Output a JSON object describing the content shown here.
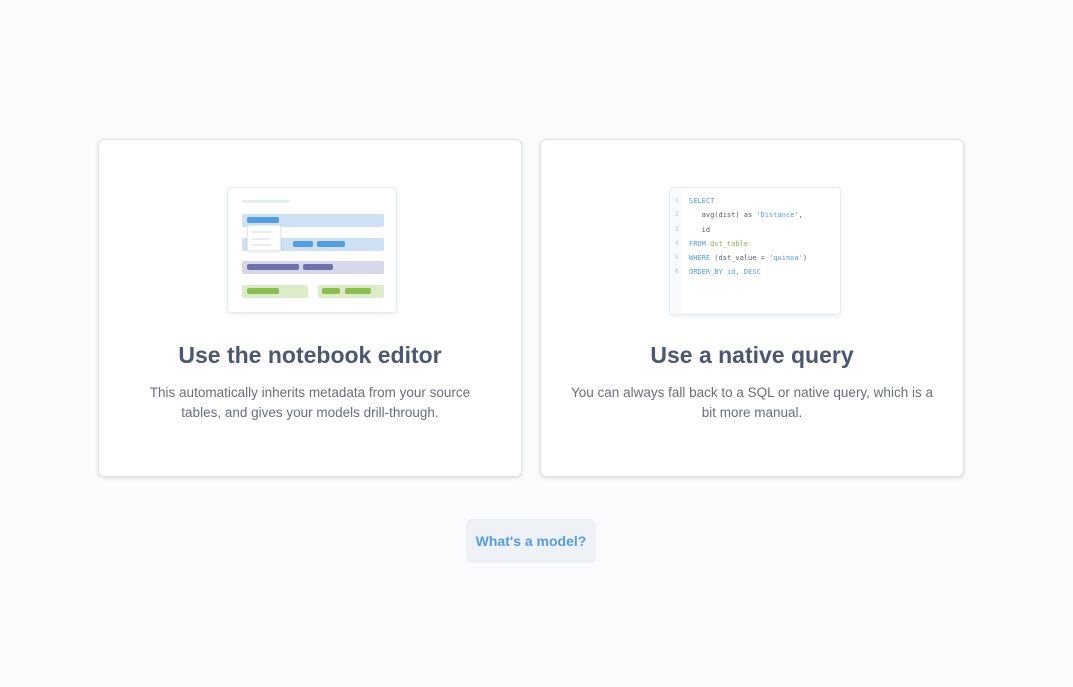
{
  "options": [
    {
      "title": "Use the notebook editor",
      "description": "This automatically inherits metadata from your source tables, and gives your models drill-through."
    },
    {
      "title": "Use a native query",
      "description": "You can always fall back to a SQL or native query, which is a bit more manual."
    }
  ],
  "code_sample": {
    "lines": [
      {
        "num": "1",
        "parts": [
          {
            "t": "SELECT",
            "c": "kw"
          }
        ]
      },
      {
        "num": "2",
        "parts": [
          {
            "t": "   avg(dist) as ",
            "c": "pl"
          },
          {
            "t": "'Distance'",
            "c": "st"
          },
          {
            "t": ",",
            "c": "pl"
          }
        ]
      },
      {
        "num": "3",
        "parts": [
          {
            "t": "   id",
            "c": "pl"
          }
        ]
      },
      {
        "num": "4",
        "parts": [
          {
            "t": "FROM ",
            "c": "kw"
          },
          {
            "t": "dst_table",
            "c": "tb"
          }
        ]
      },
      {
        "num": "5",
        "parts": [
          {
            "t": "WHERE ",
            "c": "kw"
          },
          {
            "t": "(dst_value = ",
            "c": "pl"
          },
          {
            "t": "'quinoa'",
            "c": "st"
          },
          {
            "t": ")",
            "c": "pl"
          }
        ]
      },
      {
        "num": "6",
        "parts": [
          {
            "t": "ORDER_BY ",
            "c": "kw"
          },
          {
            "t": "id, DESC",
            "c": "kw"
          }
        ]
      }
    ]
  },
  "help_button": {
    "label": "What's a model?"
  },
  "colors": {
    "brand_blue": "#509ee3",
    "title_text": "#4c5773",
    "body_text": "#696e7b",
    "purple": "#7172ad",
    "green": "#88bf4d"
  }
}
